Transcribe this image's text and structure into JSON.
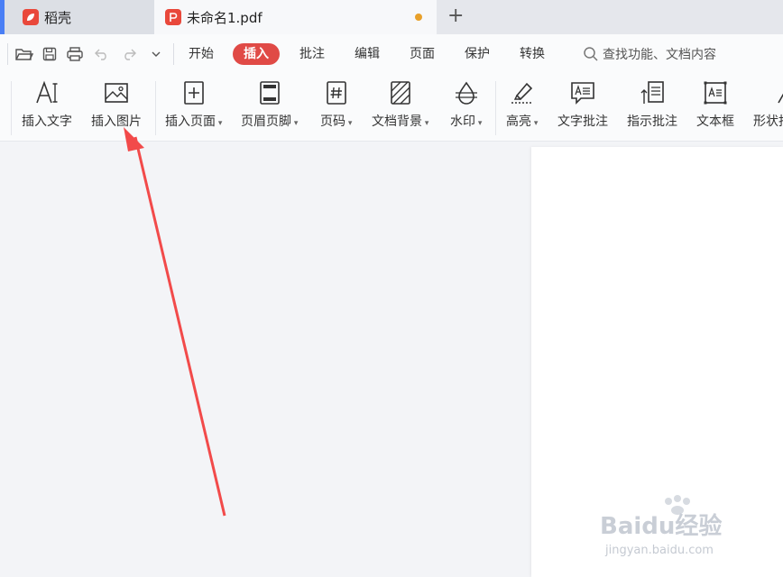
{
  "tabs": {
    "home": {
      "label": "稻壳"
    },
    "document": {
      "label": "未命名1.pdf"
    },
    "new_tab_symbol": "+"
  },
  "menu": {
    "items": [
      "开始",
      "插入",
      "批注",
      "编辑",
      "页面",
      "保护",
      "转换"
    ],
    "active": "插入",
    "search_placeholder": "查找功能、文档内容"
  },
  "ribbon": {
    "tools": [
      {
        "label": "插入文字",
        "icon": "insert-text-icon"
      },
      {
        "label": "插入图片",
        "icon": "insert-image-icon"
      },
      {
        "label": "插入页面",
        "icon": "insert-page-icon",
        "dropdown": true
      },
      {
        "label": "页眉页脚",
        "icon": "header-footer-icon",
        "dropdown": true
      },
      {
        "label": "页码",
        "icon": "page-number-icon",
        "dropdown": true
      },
      {
        "label": "文档背景",
        "icon": "document-background-icon",
        "dropdown": true
      },
      {
        "label": "水印",
        "icon": "watermark-icon",
        "dropdown": true
      },
      {
        "label": "高亮",
        "icon": "highlight-icon",
        "dropdown": true
      },
      {
        "label": "文字批注",
        "icon": "text-comment-icon"
      },
      {
        "label": "指示批注",
        "icon": "pointer-comment-icon"
      },
      {
        "label": "文本框",
        "icon": "text-box-icon"
      },
      {
        "label": "形状批",
        "icon": "shape-comment-icon"
      }
    ]
  },
  "watermark": {
    "brand": "Baidu经验",
    "url": "jingyan.baidu.com"
  },
  "colors": {
    "accent": "#e04a46",
    "arrow": "#f24a4a",
    "tab_indicator": "#4a7ff5",
    "unsaved_dot": "#e8a02a"
  }
}
